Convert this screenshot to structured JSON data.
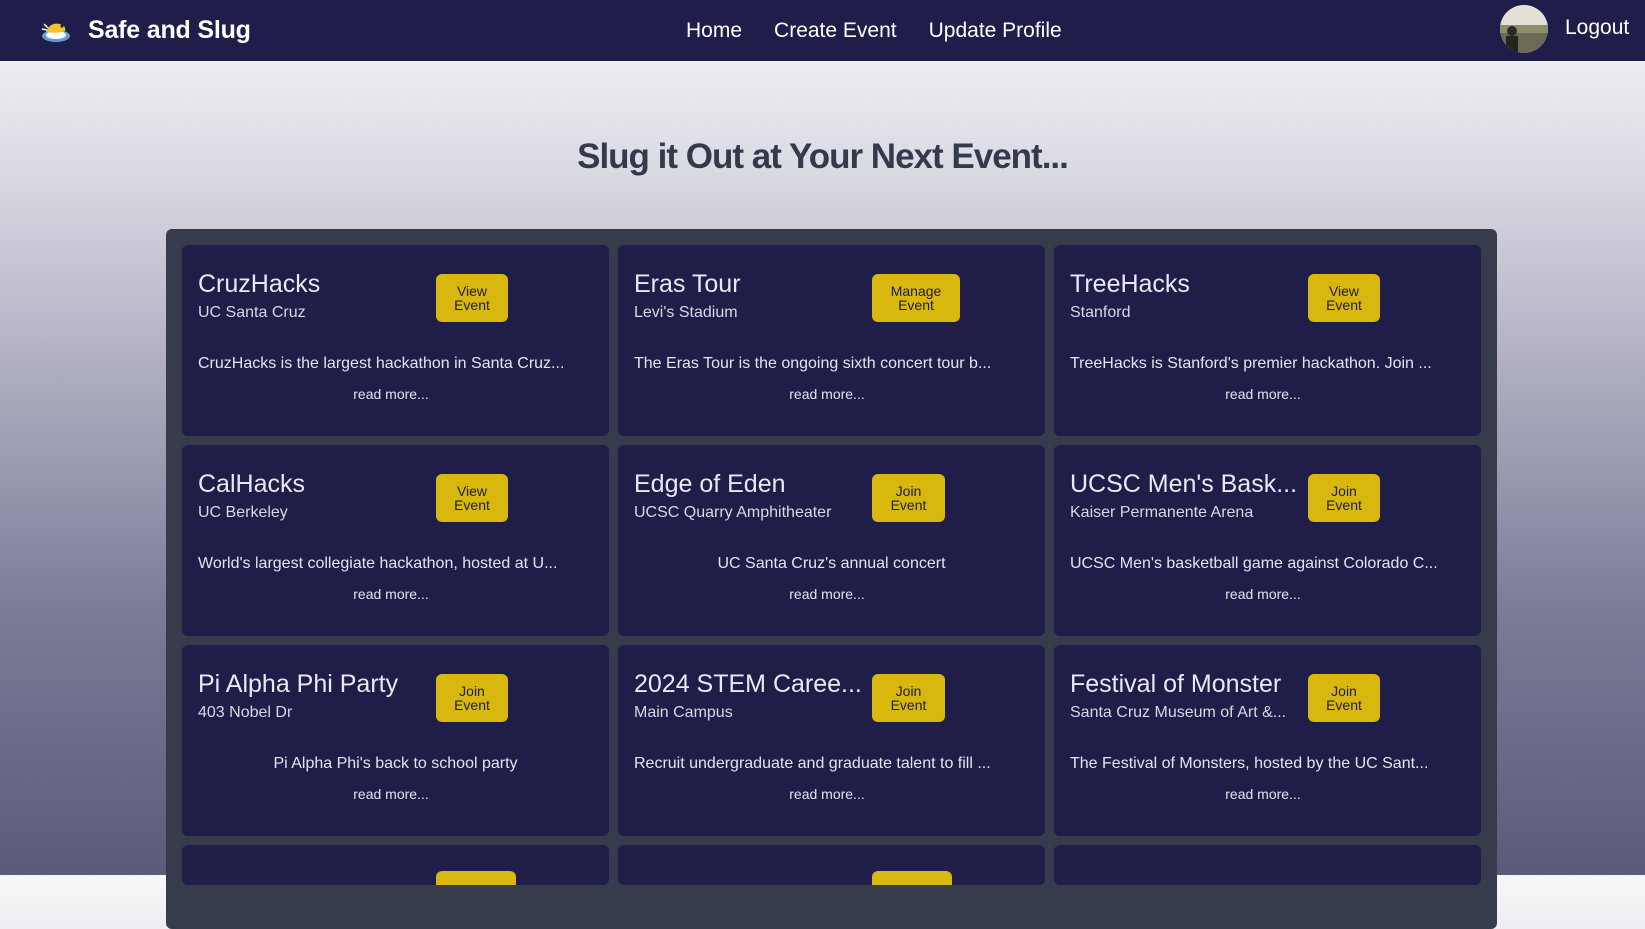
{
  "app": {
    "name": "Safe and Slug"
  },
  "nav": {
    "links": [
      "Home",
      "Create Event",
      "Update Profile"
    ],
    "logout_label": "Logout",
    "avatar_icon": "user-avatar"
  },
  "page": {
    "heading": "Slug it Out at Your Next Event..."
  },
  "colors": {
    "navbar": "#1f1d4a",
    "card": "#201d49",
    "panel": "#363c4b",
    "button": "#d8b70f"
  },
  "events": [
    {
      "title": "CruzHacks",
      "location": "UC Santa Cruz",
      "button": "View Event",
      "description": "CruzHacks is the largest hackathon in Santa Cruz...",
      "more": "read more..."
    },
    {
      "title": "Eras Tour",
      "location": "Levi's Stadium",
      "button": "Manage Event",
      "description": "The Eras Tour is the ongoing sixth concert tour b...",
      "more": "read more..."
    },
    {
      "title": "TreeHacks",
      "location": "Stanford",
      "button": "View Event",
      "description": "TreeHacks is Stanford's premier hackathon. Join ...",
      "more": "read more..."
    },
    {
      "title": "CalHacks",
      "location": "UC Berkeley",
      "button": "View Event",
      "description": "World's largest collegiate hackathon, hosted at U...",
      "more": "read more..."
    },
    {
      "title": "Edge of Eden",
      "location": "UCSC Quarry Amphitheater",
      "button": "Join Event",
      "description": "UC Santa Cruz's annual concert",
      "more": "read more..."
    },
    {
      "title": "UCSC Men's Bask...",
      "location": "Kaiser Permanente Arena",
      "button": "Join Event",
      "description": "UCSC Men's basketball game against Colorado C...",
      "more": "read more..."
    },
    {
      "title": "Pi Alpha Phi Party",
      "location": "403 Nobel Dr",
      "button": "Join Event",
      "description": "Pi Alpha Phi's back to school party",
      "more": "read more..."
    },
    {
      "title": "2024 STEM Caree...",
      "location": "Main Campus",
      "button": "Join Event",
      "description": "Recruit undergraduate and graduate talent to fill ...",
      "more": "read more..."
    },
    {
      "title": "Festival of Monster",
      "location": "Santa Cruz Museum of Art &...",
      "button": "Join Event",
      "description": "The Festival of Monsters, hosted by the UC Sant...",
      "more": "read more..."
    }
  ]
}
